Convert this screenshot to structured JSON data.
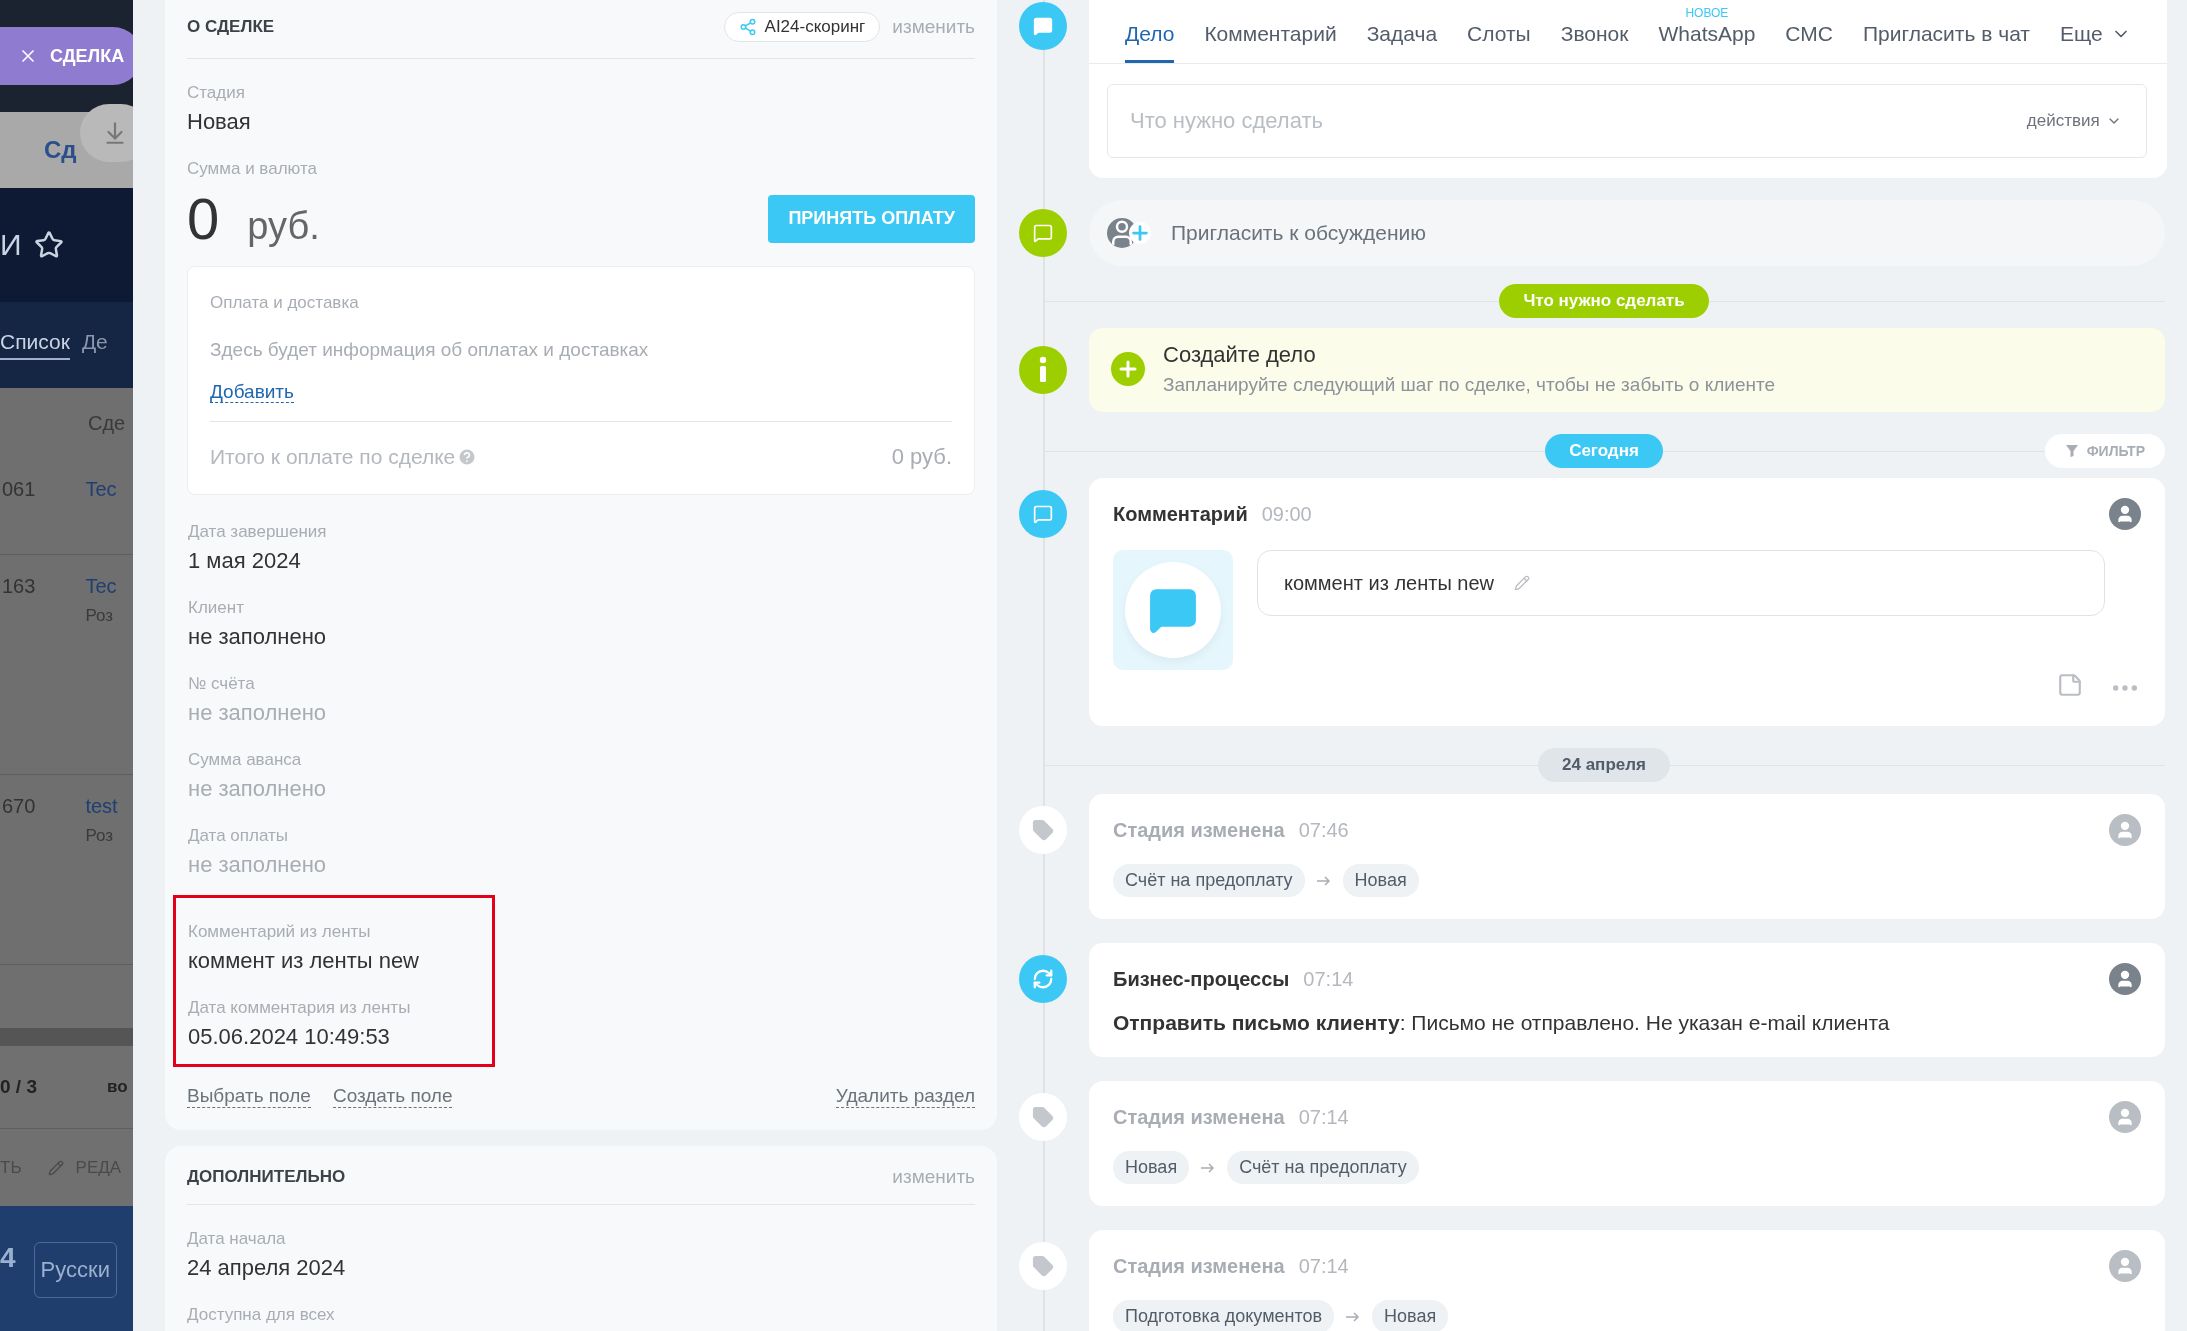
{
  "backdrop": {
    "close_label": "СДЕЛКА",
    "tab": "Сд",
    "title": "И",
    "nav": [
      {
        "label": "Список",
        "selected": true
      },
      {
        "label": "Де",
        "selected": false
      }
    ],
    "column_header": "Сде",
    "rows": [
      {
        "id": "061",
        "name": "Tec"
      },
      {
        "id": "163",
        "name": "Tec",
        "sub": "Роз"
      },
      {
        "id": "670",
        "name": "test",
        "sub": "Роз"
      }
    ],
    "counter": "0 / 3",
    "counter_next": "во",
    "actions": [
      "ТЬ",
      "РЕДА"
    ],
    "footer": [
      "4",
      "Русски"
    ]
  },
  "deal": {
    "title": "О СДЕЛКЕ",
    "badge": "AI24-скоринг",
    "edit": "изменить",
    "stage": {
      "label": "Стадия",
      "value": "Новая"
    },
    "amount": {
      "label": "Сумма и валюта",
      "value": "0",
      "currency": "руб.",
      "button": "ПРИНЯТЬ ОПЛАТУ"
    },
    "payment": {
      "title": "Оплата и доставка",
      "text": "Здесь будет информация об оплатах и доставках",
      "link": "Добавить",
      "total_label": "Итого к оплате по сделке",
      "total": "0 руб."
    },
    "field_groups": [
      {
        "highlighted": false,
        "fields": [
          {
            "label": "Дата завершения",
            "value": "1 мая 2024",
            "kind": "filled"
          },
          {
            "label": "Клиент",
            "value": "не заполнено",
            "kind": "filled"
          },
          {
            "label": "№ счёта",
            "value": "не заполнено",
            "kind": "empty"
          },
          {
            "label": "Сумма аванса",
            "value": "не заполнено",
            "kind": "empty"
          },
          {
            "label": "Дата оплаты",
            "value": "не заполнено",
            "kind": "empty"
          }
        ]
      },
      {
        "highlighted": true,
        "fields": [
          {
            "label": "Комментарий из ленты",
            "value": "коммент из ленты new",
            "kind": "filled"
          },
          {
            "label": "Дата комментария из ленты",
            "value": "05.06.2024 10:49:53",
            "kind": "filled"
          }
        ]
      }
    ],
    "links": [
      "Выбрать поле",
      "Создать поле"
    ],
    "delete_link": "Удалить раздел"
  },
  "extra": {
    "title": "ДОПОЛНИТЕЛЬНО",
    "edit": "изменить",
    "fields": [
      {
        "label": "Дата начала",
        "value": "24 апреля 2024"
      },
      {
        "label": "Доступна для всех"
      }
    ]
  },
  "timeline": {
    "tabs": [
      {
        "label": "Дело",
        "selected": true
      },
      {
        "label": "Комментарий",
        "selected": false
      },
      {
        "label": "Задача",
        "selected": false
      },
      {
        "label": "Слоты",
        "selected": false
      },
      {
        "label": "Звонок",
        "selected": false
      },
      {
        "label": "WhatsApp",
        "selected": false,
        "badge": "НОВОЕ"
      },
      {
        "label": "СМС",
        "selected": false
      },
      {
        "label": "Пригласить в чат",
        "selected": false
      },
      {
        "label": "Еще",
        "selected": false
      }
    ],
    "composer": {
      "placeholder": "Что нужно сделать",
      "actions": "действия"
    },
    "invite": "Пригласить к обсуждению",
    "planned_label": "Что нужно сделать",
    "todo": {
      "title": "Создайте дело",
      "text": "Запланируйте следующий шаг по сделке, чтобы не забыть о клиенте"
    },
    "today_label": "Сегодня",
    "filter": "ФИЛЬТР",
    "comment": {
      "title": "Комментарий",
      "time": "09:00",
      "text": "коммент из ленты new"
    },
    "date_label": "24 апреля",
    "history": [
      {
        "kind": "stage",
        "title": "Стадия изменена",
        "time": "07:46",
        "from": "Счёт на предоплату",
        "to": "Новая"
      },
      {
        "kind": "process",
        "title": "Бизнес-процессы",
        "time": "07:14",
        "text": "**Отправить письмо клиенту**: Письмо не отправлено. Не указан e-mail клиента"
      },
      {
        "kind": "stage",
        "title": "Стадия изменена",
        "time": "07:14",
        "from": "Новая",
        "to": "Счёт на предоплату"
      },
      {
        "kind": "stage",
        "title": "Стадия изменена",
        "time": "07:14",
        "from": "Подготовка документов",
        "to": "Новая"
      }
    ]
  }
}
